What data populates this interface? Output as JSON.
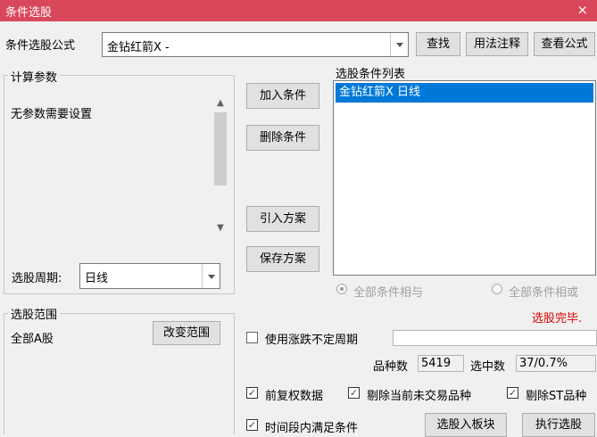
{
  "window": {
    "title": "条件选股",
    "close": "×"
  },
  "formula": {
    "label": "条件选股公式",
    "value": "金钻红箭X  -"
  },
  "buttons": {
    "find": "查找",
    "usage": "用法注释",
    "view": "查看公式",
    "add": "加入条件",
    "delete": "删除条件",
    "import": "引入方案",
    "save": "保存方案",
    "change_range": "改变范围",
    "select_to_block": "选股入板块",
    "run": "执行选股"
  },
  "params": {
    "title": "计算参数",
    "text": "无参数需要设置",
    "period_label": "选股周期:",
    "period_value": "日线"
  },
  "conditions": {
    "title": "选股条件列表",
    "items": [
      "金钻红箭X  日线"
    ],
    "radio_and": "全部条件相与",
    "radio_or": "全部条件相或"
  },
  "status": {
    "text": "选股完毕.",
    "color": "#e00000"
  },
  "range": {
    "title": "选股范围",
    "value": "全部A股"
  },
  "options": {
    "uneven_period": "使用涨跌不定周期",
    "total_label": "品种数",
    "total_value": "5419",
    "selected_label": "选中数",
    "selected_value": "37/0.7%",
    "pre_adjust": "前复权数据",
    "exclude_untraded": "剔除当前未交易品种",
    "exclude_st": "剔除ST品种",
    "time_period": "时间段内满足条件",
    "check_mark": "✓"
  },
  "colors": {
    "titlebar": "#d9475a",
    "selection": "#0078d7"
  }
}
